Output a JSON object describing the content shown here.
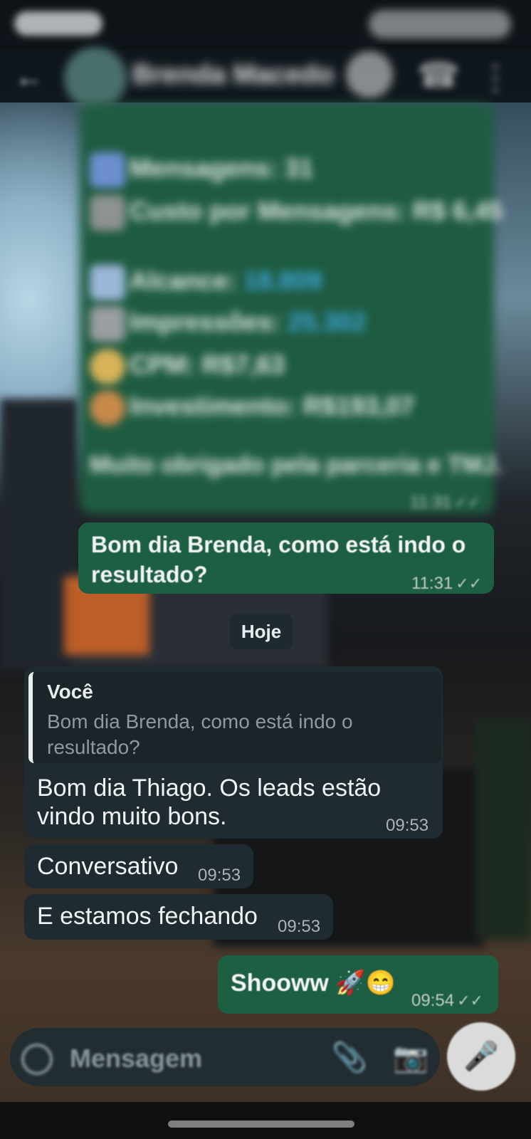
{
  "colors": {
    "outgoing_bubble": "#1d5f43",
    "incoming_bubble": "#1f2b31",
    "link_blue": "#3fa8e0",
    "header_bg": "#0c1216"
  },
  "header": {
    "back_icon": "arrow-left-icon",
    "contact_name": "Brenda Macedo",
    "actions": [
      "video-call-icon",
      "phone-icon",
      "more-vert-icon"
    ]
  },
  "blurred_message": {
    "lines": [
      {
        "label": "Mensagens: 31",
        "value": ""
      },
      {
        "label": "Custo por Mensagens: R$ 6,45",
        "value": ""
      },
      {
        "label": "Alcance: ",
        "value": "18.809"
      },
      {
        "label": "Impressões: ",
        "value": "25.302"
      },
      {
        "label": "CPM: R$7,63",
        "value": ""
      },
      {
        "label": "Investimento: R$193,07",
        "value": ""
      },
      {
        "label": "Muito obrigado pela parceria e TMJ.",
        "value": ""
      }
    ],
    "time": "11:31"
  },
  "messages": [
    {
      "text_1": "Bom dia Brenda, como está indo o",
      "text_2": "resultado?",
      "time": "11:31"
    }
  ],
  "date_divider": "Hoje",
  "reply": {
    "quote_author": "Você",
    "quote_text": "Bom dia Brenda, como está indo o resultado?",
    "text_1": "Bom dia Thiago. Os leads estão",
    "text_2": "vindo muito bons.",
    "time": "09:53"
  },
  "incoming": [
    {
      "text": "Conversativo",
      "time": "09:53"
    },
    {
      "text": "E estamos fechando",
      "time": "09:53"
    }
  ],
  "outgoing_last": {
    "text": "Shooww 🚀😁",
    "time": "09:54"
  },
  "composer": {
    "placeholder": "Mensagem",
    "emoji_icon": "sticker-icon",
    "attach_icon": "paperclip-icon",
    "camera_icon": "camera-icon",
    "mic_icon": "microphone-icon"
  }
}
